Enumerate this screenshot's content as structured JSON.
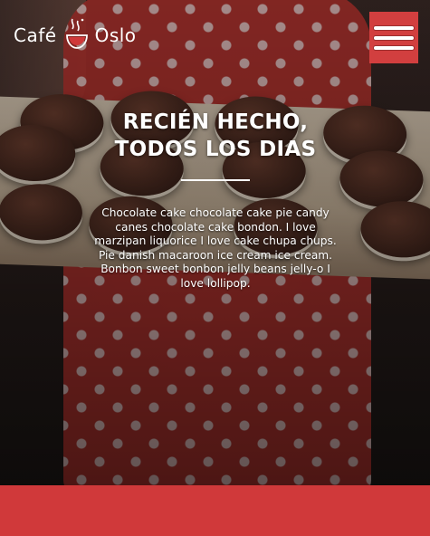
{
  "header": {
    "brand_left": "Café",
    "brand_right": "Oslo",
    "logo_icon": "coffee-cup-icon",
    "menu_icon": "hamburger-menu-icon",
    "menu_color": "#d23f3f"
  },
  "hero": {
    "title_line1": "RECIÉN HECHO,",
    "title_line2": "TODOS LOS DIAS",
    "body": "Chocolate cake chocolate cake pie candy canes chocolate cake bondon. I love marzipan liquorice I love cake chupa chups. Pie danish macaroon ice cream ice cream. Bonbon sweet bonbon jelly beans jelly-o I love lollipop."
  },
  "colors": {
    "accent": "#d0393a",
    "text": "#ffffff"
  }
}
